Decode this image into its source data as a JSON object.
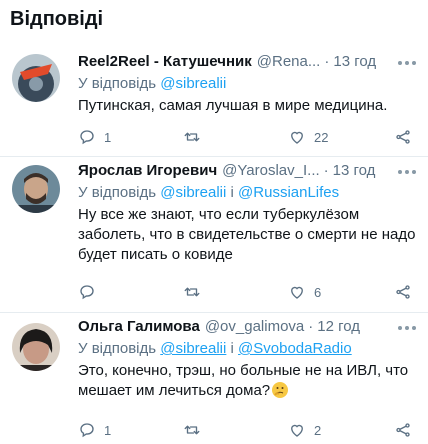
{
  "section_title": "Відповіді",
  "tweets": [
    {
      "author": "Reel2Reel - Катушечник",
      "handle": "@Rena...",
      "time": "13 год",
      "reply_prefix": "У відповідь",
      "reply_mentions": [
        "@sibrealii"
      ],
      "reply_joiner": "",
      "text": "Путинская, самая лучшая в мире медицина.",
      "reply_count": "1",
      "retweet_count": "",
      "like_count": "22",
      "avatar_colors": {
        "bg": "#b9c6ce",
        "fg": "#3a4a5a",
        "accent": "#e24b2b"
      }
    },
    {
      "author": "Ярослав Игоревич",
      "handle": "@Yaroslav_I...",
      "time": "13 год",
      "reply_prefix": "У відповідь",
      "reply_mentions": [
        "@sibrealii",
        "@RussianLifes"
      ],
      "reply_joiner": "і",
      "text": "Ну все же знают, что если туберкулёзом заболеть, что в свидетельстве о смерти не надо будет писать о ковиде",
      "reply_count": "",
      "retweet_count": "",
      "like_count": "6",
      "avatar_colors": {
        "bg": "#6d8a9a",
        "fg": "#3b2f28",
        "accent": "#c9a58a"
      }
    },
    {
      "author": "Ольга Галимова",
      "handle": "@ov_galimova",
      "time": "12 год",
      "reply_prefix": "У відповідь",
      "reply_mentions": [
        "@sibrealii",
        "@SvobodaRadio"
      ],
      "reply_joiner": "і",
      "text": "Это, конечно, трэш, но больные не на ИВЛ, что мешает им лечиться дома?",
      "text_emoji": "thinking-face-emoji",
      "reply_count": "1",
      "retweet_count": "",
      "like_count": "2",
      "avatar_colors": {
        "bg": "#d9cfc4",
        "fg": "#1c1a19",
        "accent": "#c79a86"
      }
    }
  ],
  "icons": {
    "reply": "reply-icon",
    "retweet": "retweet-icon",
    "like": "heart-icon",
    "share": "share-icon",
    "more": "more-options-icon"
  },
  "colors": {
    "text": "#0f1419",
    "secondary": "#5b7083",
    "link": "#1da1f2",
    "divider": "#e6ecf0",
    "icon": "#8899a6"
  }
}
